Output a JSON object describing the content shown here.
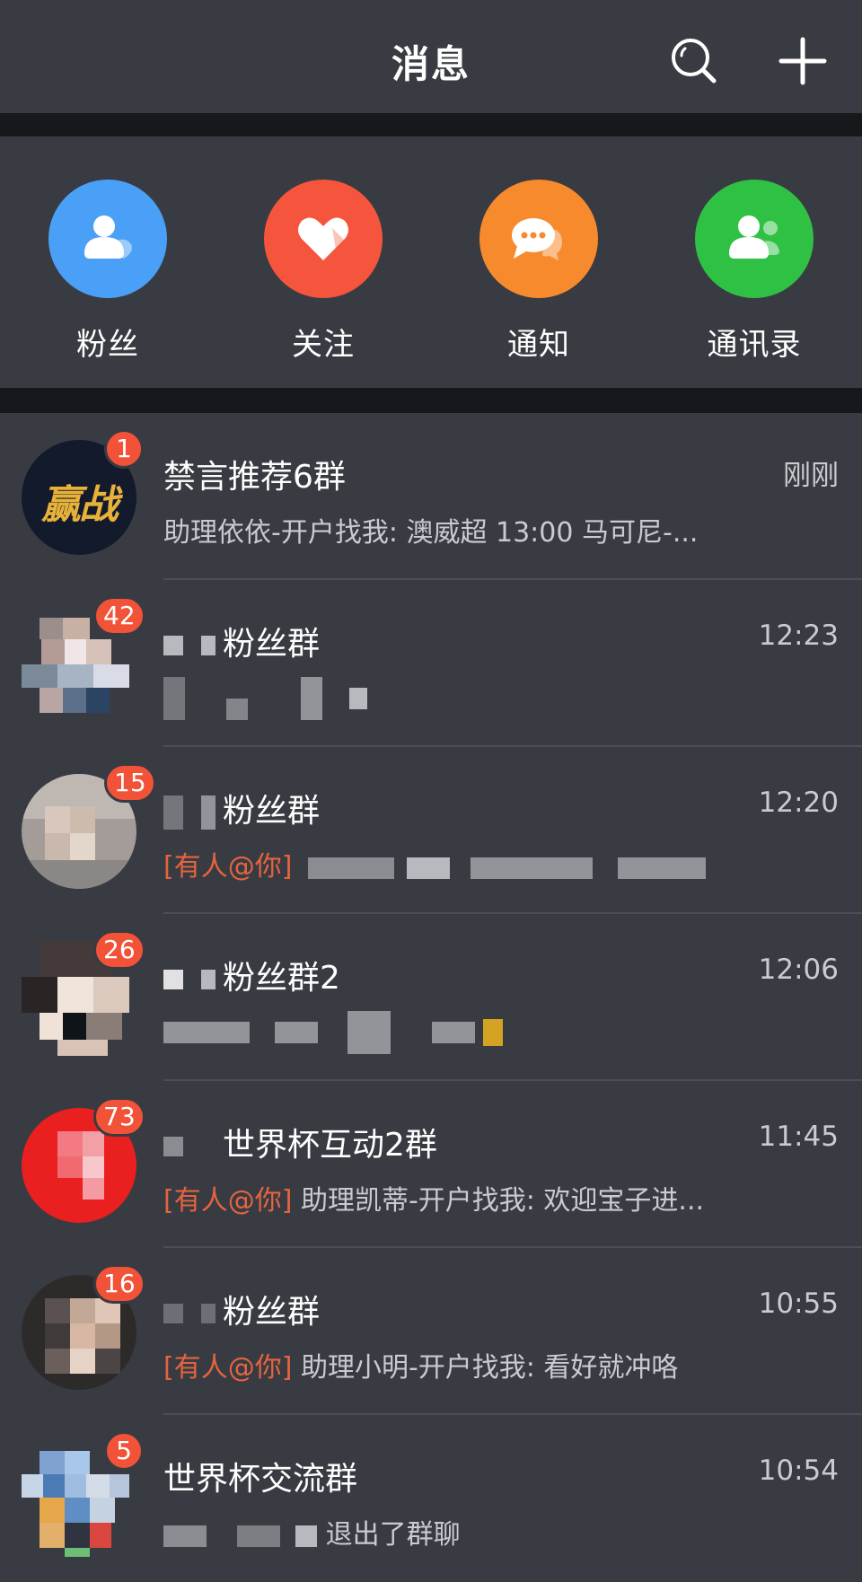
{
  "header": {
    "title": "消息"
  },
  "quick": [
    {
      "label": "粉丝",
      "icon": "fans-icon",
      "color": "#4aa0f7"
    },
    {
      "label": "关注",
      "icon": "heart-icon",
      "color": "#f4553c"
    },
    {
      "label": "通知",
      "icon": "chat-bubble-icon",
      "color": "#f88a2e"
    },
    {
      "label": "通讯录",
      "icon": "contacts-icon",
      "color": "#2fc144"
    }
  ],
  "chats": [
    {
      "badge": "1",
      "name": "禁言推荐6群",
      "time": "刚刚",
      "preview": "助理依依-开户找我: 澳威超  13:00    马可尼-...",
      "avatar_text": "赢战"
    },
    {
      "badge": "42",
      "name": "粉丝群",
      "time": "12:23",
      "preview": ""
    },
    {
      "badge": "15",
      "name": "粉丝群",
      "time": "12:20",
      "mention": "[有人@你]",
      "preview": ""
    },
    {
      "badge": "26",
      "name": "粉丝群2",
      "time": "12:06",
      "preview": ""
    },
    {
      "badge": "73",
      "name": "世界杯互动2群",
      "time": "11:45",
      "mention": "[有人@你]",
      "preview": "助理凯蒂-开户找我: 欢迎宝子进..."
    },
    {
      "badge": "16",
      "name": "粉丝群",
      "time": "10:55",
      "mention": "[有人@你]",
      "preview": "助理小明-开户找我: 看好就冲咯"
    },
    {
      "badge": "5",
      "name": "世界杯交流群",
      "time": "10:54",
      "preview": "退出了群聊"
    }
  ]
}
